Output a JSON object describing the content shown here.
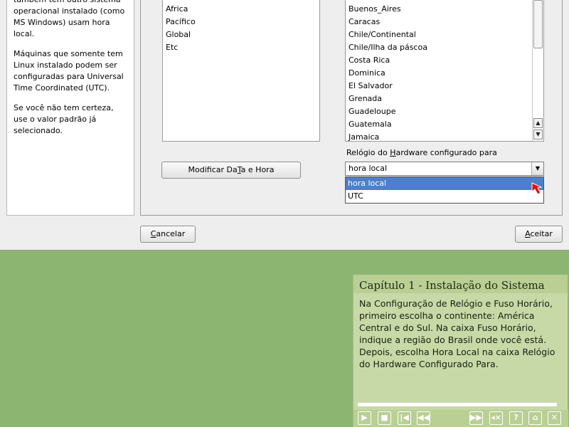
{
  "help": {
    "para1": "também tem outro sistema operacional instalado (como MS Windows) usam hora local.",
    "para2": "Máquinas que somente tem Linux instalado podem ser configuradas para Universal Time Coordinated (UTC).",
    "para3": "Se você não tem certeza, use o valor padrão já selecionado."
  },
  "regions": [
    "Africa",
    "Pacífico",
    "Global",
    "Etc"
  ],
  "timezones": [
    "Buenos_Aires",
    "Caracas",
    "Chile/Continental",
    "Chile/Ilha da páscoa",
    "Costa Rica",
    "Dominica",
    "El Salvador",
    "Grenada",
    "Guadeloupe",
    "Guatemala",
    "Jamaica"
  ],
  "hw_clock": {
    "label_pre": "Relógio do ",
    "label_mnemonic": "H",
    "label_post": "ardware configurado para",
    "value": "hora local",
    "options": [
      "hora local",
      "UTC"
    ]
  },
  "buttons": {
    "modify_pre": "Modificar Da",
    "modify_mnemonic": "T",
    "modify_post": "a e Hora",
    "cancel_mnemonic": "C",
    "cancel_rest": "ancelar",
    "accept_mnemonic": "A",
    "accept_rest": "ceitar"
  },
  "tutorial": {
    "title": "Capítulo 1 - Instalação do Sistema",
    "body": "Na Configuração de Relógio e Fuso Horário, primeiro escolha o continente: América Central e do Sul. Na caixa Fuso Horário, indique a região do Brasil onde você está. Depois, escolha Hora Local na caixa Relógio do Hardware Configurado Para.",
    "progress": 0.0
  },
  "icons": {
    "controls": [
      "play-icon",
      "stop-icon",
      "skip-back-icon",
      "rewind-icon",
      "fast-forward-icon",
      "mute-icon",
      "help-icon",
      "home-icon",
      "close-icon"
    ]
  },
  "colors": {
    "selection": "#4f7fc8",
    "desktop": "#8db572",
    "tutorial_bg": "#c8d9a8"
  }
}
